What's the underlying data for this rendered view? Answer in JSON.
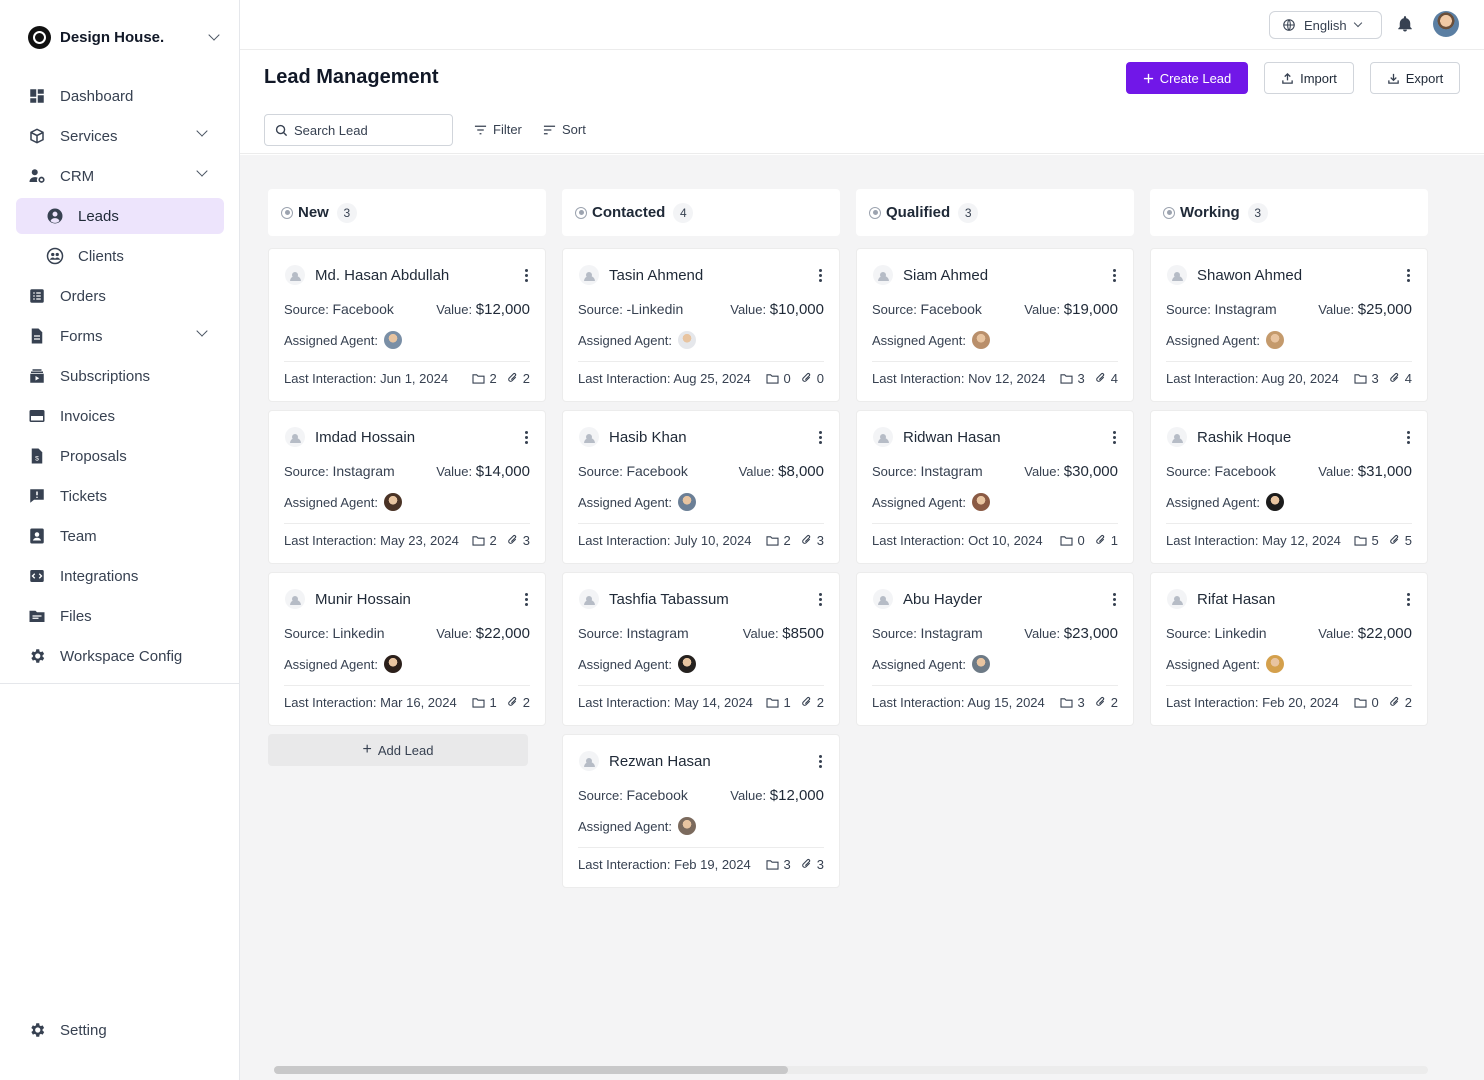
{
  "brand": {
    "name": "Design House."
  },
  "sidebar": {
    "items": [
      {
        "label": "Dashboard",
        "icon": "dashboard-icon",
        "chevron": false,
        "sub": false,
        "active": false
      },
      {
        "label": "Services",
        "icon": "box-icon",
        "chevron": true,
        "sub": false,
        "active": false
      },
      {
        "label": "CRM",
        "icon": "users-gear-icon",
        "chevron": true,
        "sub": false,
        "active": false
      },
      {
        "label": "Leads",
        "icon": "user-circle-icon",
        "chevron": false,
        "sub": true,
        "active": true
      },
      {
        "label": "Clients",
        "icon": "clients-icon",
        "chevron": false,
        "sub": true,
        "active": false
      },
      {
        "label": "Orders",
        "icon": "list-icon",
        "chevron": false,
        "sub": false,
        "active": false
      },
      {
        "label": "Forms",
        "icon": "document-icon",
        "chevron": true,
        "sub": false,
        "active": false
      },
      {
        "label": "Subscriptions",
        "icon": "subscriptions-icon",
        "chevron": false,
        "sub": false,
        "active": false
      },
      {
        "label": "Invoices",
        "icon": "credit-card-icon",
        "chevron": false,
        "sub": false,
        "active": false
      },
      {
        "label": "Proposals",
        "icon": "proposal-icon",
        "chevron": false,
        "sub": false,
        "active": false
      },
      {
        "label": "Tickets",
        "icon": "ticket-icon",
        "chevron": false,
        "sub": false,
        "active": false
      },
      {
        "label": "Team",
        "icon": "team-icon",
        "chevron": false,
        "sub": false,
        "active": false
      },
      {
        "label": "Integrations",
        "icon": "integrations-icon",
        "chevron": false,
        "sub": false,
        "active": false
      },
      {
        "label": "Files",
        "icon": "folder-icon",
        "chevron": false,
        "sub": false,
        "active": false
      },
      {
        "label": "Workspace Config",
        "icon": "gear-icon",
        "chevron": false,
        "sub": false,
        "active": false
      }
    ],
    "setting_label": "Setting"
  },
  "topbar": {
    "language": "English"
  },
  "header": {
    "title": "Lead Management",
    "create_label": "Create Lead",
    "import_label": "Import",
    "export_label": "Export",
    "search_placeholder": "Search Lead",
    "filter_label": "Filter",
    "sort_label": "Sort"
  },
  "labels": {
    "source": "Source:",
    "value": "Value:",
    "agent": "Assigned Agent:",
    "last": "Last Interaction:",
    "add_lead": "Add Lead"
  },
  "accent_color": "#7117e8",
  "columns": [
    {
      "title": "New",
      "count": "3",
      "cards": [
        {
          "name": "Md. Hasan Abdullah",
          "source": "Facebook",
          "value": "$12,000",
          "last": "Jun 1, 2024",
          "files": "2",
          "attachments": "2",
          "agent_color": "#7a8fa6"
        },
        {
          "name": "Imdad Hossain",
          "source": "Instagram",
          "value": "$14,000",
          "last": "May 23, 2024",
          "files": "2",
          "attachments": "3",
          "agent_color": "#4a3326"
        },
        {
          "name": "Munir Hossain",
          "source": "Linkedin",
          "value": "$22,000",
          "last": "Mar 16, 2024",
          "files": "1",
          "attachments": "2",
          "agent_color": "#2b1f1a"
        }
      ]
    },
    {
      "title": "Contacted",
      "count": "4",
      "cards": [
        {
          "name": "Tasin Ahmend",
          "source": "-Linkedin",
          "value": "$10,000",
          "last": "Aug 25, 2024",
          "files": "0",
          "attachments": "0",
          "agent_color": "#e5e7eb"
        },
        {
          "name": "Hasib Khan",
          "source": "Facebook",
          "value": "$8,000",
          "last": "July 10, 2024",
          "files": "2",
          "attachments": "3",
          "agent_color": "#6b7f96"
        },
        {
          "name": "Tashfia Tabassum",
          "source": "Instagram",
          "value": "$8500",
          "last": "May 14, 2024",
          "files": "1",
          "attachments": "2",
          "agent_color": "#25211f"
        },
        {
          "name": "Rezwan Hasan",
          "source": "Facebook",
          "value": "$12,000",
          "last": "Feb 19, 2024",
          "files": "3",
          "attachments": "3",
          "agent_color": "#7b6a5d"
        }
      ]
    },
    {
      "title": "Qualified",
      "count": "3",
      "cards": [
        {
          "name": "Siam Ahmed",
          "source": "Facebook",
          "value": "$19,000",
          "last": "Nov 12, 2024",
          "files": "3",
          "attachments": "4",
          "agent_color": "#b98f6b"
        },
        {
          "name": "Ridwan Hasan",
          "source": "Instagram",
          "value": "$30,000",
          "last": "Oct 10, 2024",
          "files": "0",
          "attachments": "1",
          "agent_color": "#8a5a44"
        },
        {
          "name": "Abu Hayder",
          "source": "Instagram",
          "value": "$23,000",
          "last": "Aug 15, 2024",
          "files": "3",
          "attachments": "2",
          "agent_color": "#6d7a86"
        }
      ]
    },
    {
      "title": "Working",
      "count": "3",
      "cards": [
        {
          "name": "Shawon Ahmed",
          "source": "Instagram",
          "value": "$25,000",
          "last": "Aug 20, 2024",
          "files": "3",
          "attachments": "4",
          "agent_color": "#c49a6c"
        },
        {
          "name": "Rashik Hoque",
          "source": "Facebook",
          "value": "$31,000",
          "last": "May 12, 2024",
          "files": "5",
          "attachments": "5",
          "agent_color": "#1c1c1c"
        },
        {
          "name": "Rifat Hasan",
          "source": "Linkedin",
          "value": "$22,000",
          "last": "Feb 20, 2024",
          "files": "0",
          "attachments": "2",
          "agent_color": "#d4a04c"
        }
      ]
    }
  ]
}
